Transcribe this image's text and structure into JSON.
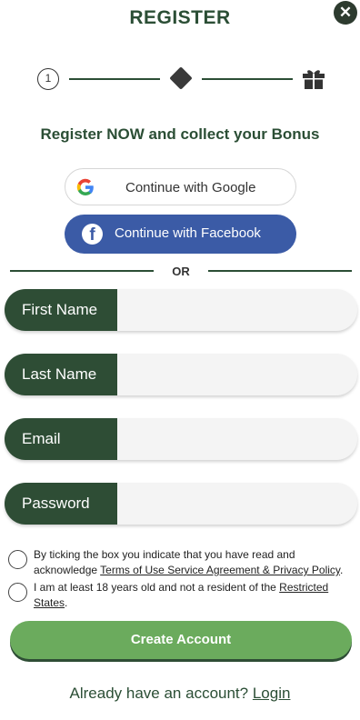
{
  "header": {
    "title": "REGISTER",
    "close_icon": "close-icon"
  },
  "stepper": {
    "step1": "1",
    "step2_icon": "diamond-icon",
    "step3_icon": "gift-icon"
  },
  "subtitle": "Register NOW and collect your Bonus",
  "social": {
    "google_label": "Continue with Google",
    "facebook_label": "Continue with Facebook",
    "facebook_color": "#3b5ba6"
  },
  "divider": {
    "or": "OR"
  },
  "fields": {
    "first_name": {
      "label": "First Name",
      "value": ""
    },
    "last_name": {
      "label": "Last Name",
      "value": ""
    },
    "email": {
      "label": "Email",
      "value": ""
    },
    "password": {
      "label": "Password",
      "value": ""
    }
  },
  "consent": {
    "terms_prefix": "By ticking the box you indicate that you have read and acknowledge ",
    "terms_link": "Terms of Use Service Agreement & Privacy Policy",
    "terms_suffix": ".",
    "age_prefix": "I am at least 18 years old and not a resident of the ",
    "age_link": "Restricted States",
    "age_suffix": "."
  },
  "create_button": "Create Account",
  "login": {
    "prompt": "Already have an account? ",
    "link": "Login"
  },
  "colors": {
    "brand_dark": "#2e4d35",
    "accent_green": "#6bab5d"
  }
}
